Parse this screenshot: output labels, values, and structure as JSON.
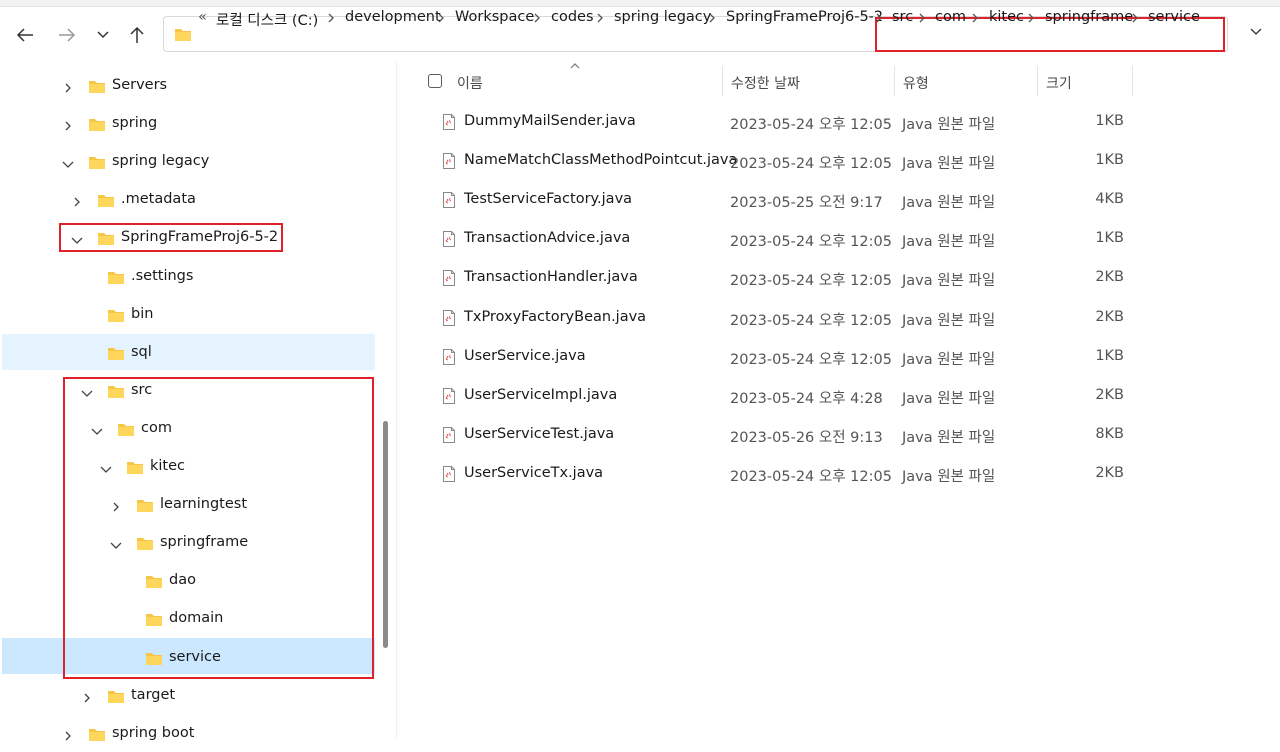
{
  "nav": {
    "back": "back",
    "forward": "forward",
    "recent": "recent-locations",
    "up": "up-one-level"
  },
  "address": {
    "overflow": "«",
    "crumbs": [
      "로컬 디스크 (C:)",
      "development",
      "Workspace",
      "codes",
      "spring legacy",
      "SpringFrameProj6-5-2",
      "src",
      "com",
      "kitec",
      "springframe",
      "service"
    ]
  },
  "tree": [
    {
      "label": "Servers"
    },
    {
      "label": "spring"
    },
    {
      "label": "spring legacy"
    },
    {
      "label": ".metadata"
    },
    {
      "label": "SpringFrameProj6-5-2"
    },
    {
      "label": ".settings"
    },
    {
      "label": "bin"
    },
    {
      "label": "sql"
    },
    {
      "label": "src"
    },
    {
      "label": "com"
    },
    {
      "label": "kitec"
    },
    {
      "label": "learningtest"
    },
    {
      "label": "springframe"
    },
    {
      "label": "dao"
    },
    {
      "label": "domain"
    },
    {
      "label": "service"
    },
    {
      "label": "target"
    },
    {
      "label": "spring boot"
    }
  ],
  "columns": {
    "name": "이름",
    "date": "수정한 날짜",
    "type": "유형",
    "size": "크기"
  },
  "files": [
    {
      "name": "DummyMailSender.java",
      "date": "2023-05-24 오후 12:05",
      "type": "Java 원본 파일",
      "size": "1KB"
    },
    {
      "name": "NameMatchClassMethodPointcut.java",
      "date": "2023-05-24 오후 12:05",
      "type": "Java 원본 파일",
      "size": "1KB"
    },
    {
      "name": "TestServiceFactory.java",
      "date": "2023-05-25 오전 9:17",
      "type": "Java 원본 파일",
      "size": "4KB"
    },
    {
      "name": "TransactionAdvice.java",
      "date": "2023-05-24 오후 12:05",
      "type": "Java 원본 파일",
      "size": "1KB"
    },
    {
      "name": "TransactionHandler.java",
      "date": "2023-05-24 오후 12:05",
      "type": "Java 원본 파일",
      "size": "2KB"
    },
    {
      "name": "TxProxyFactoryBean.java",
      "date": "2023-05-24 오후 12:05",
      "type": "Java 원본 파일",
      "size": "2KB"
    },
    {
      "name": "UserService.java",
      "date": "2023-05-24 오후 12:05",
      "type": "Java 원본 파일",
      "size": "1KB"
    },
    {
      "name": "UserServiceImpl.java",
      "date": "2023-05-24 오후 4:28",
      "type": "Java 원본 파일",
      "size": "2KB"
    },
    {
      "name": "UserServiceTest.java",
      "date": "2023-05-26 오전 9:13",
      "type": "Java 원본 파일",
      "size": "8KB"
    },
    {
      "name": "UserServiceTx.java",
      "date": "2023-05-24 오후 12:05",
      "type": "Java 원본 파일",
      "size": "2KB"
    }
  ],
  "colors": {
    "highlight": "#e0202a",
    "selected": "#cce8ff",
    "hover": "#e5f3ff",
    "folder": "#f6c644"
  }
}
